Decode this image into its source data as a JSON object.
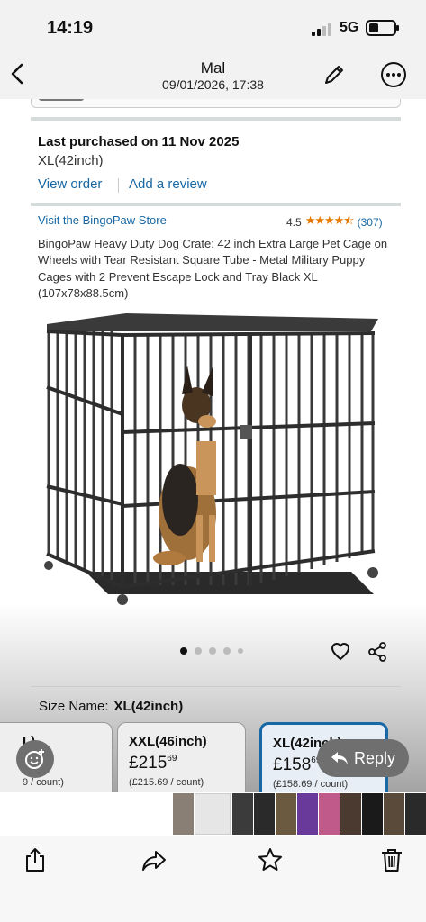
{
  "status_bar": {
    "time": "14:19",
    "network": "5G"
  },
  "header": {
    "sender": "Mal",
    "timestamp": "09/01/2026, 17:38"
  },
  "order": {
    "purchased_label": "Last purchased on 11 Nov 2025",
    "variant": "XL(42inch)",
    "view_order": "View order",
    "add_review": "Add a review"
  },
  "product": {
    "store_link": "Visit the BingoPaw Store",
    "rating": "4.5",
    "stars": "★★★★⯪",
    "review_count": "(307)",
    "description": "BingoPaw Heavy Duty Dog Crate: 42 inch Extra Large Pet Cage on Wheels with Tear Resistant Square Tube - Metal Military Puppy Cages with 2 Prevent Escape Lock and Tray Black XL (107x78x88.5cm)",
    "image_count": 5,
    "active_image": 1
  },
  "size": {
    "label": "Size Name:",
    "selected": "XL(42inch)",
    "options": [
      {
        "name": "L)",
        "price_main": "",
        "price_frac": "",
        "unit": "9 / count)"
      },
      {
        "name": "XXL(46inch)",
        "price_main": "£215",
        "price_frac": "69",
        "unit": "(£215.69 / count)"
      },
      {
        "name": "XL(42inch)",
        "price_main": "£158",
        "price_frac": "69",
        "unit": "(£158.69 / count)"
      }
    ]
  },
  "reply": {
    "label": "Reply"
  },
  "colors": {
    "accent": "#1768a4",
    "star": "#e67a00"
  }
}
